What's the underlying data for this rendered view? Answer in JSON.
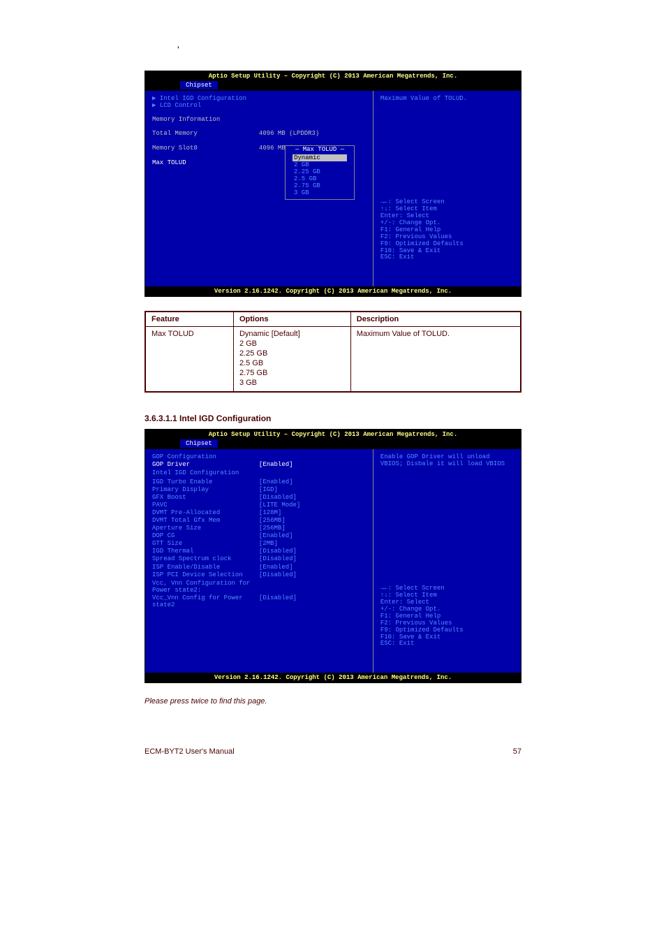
{
  "small_mark": ",",
  "bios1": {
    "header": "Aptio Setup Utility – Copyright (C) 2013 American Megatrends, Inc.",
    "tab": "Chipset",
    "rows": {
      "link1": "▶ Intel IGD Configuration",
      "link2": "▶ LCD Control",
      "meminfo": "Memory Information",
      "totalmem_l": "Total Memory",
      "totalmem_v": "4096 MB (LPDDR3)",
      "memslot_l": "Memory Slot0",
      "memslot_v": "4096 MB (LPDDR3)",
      "maxtolud_l": "Max TOLUD"
    },
    "popup": {
      "title": "— Max TOLUD —",
      "opts": [
        "Dynamic",
        "2 GB",
        "2.25 GB",
        "2.5 GB",
        "2.75 GB",
        "3 GB"
      ]
    },
    "help_top": "Maximum Value of TOLUD.",
    "help": [
      "→←: Select Screen",
      "↑↓: Select Item",
      "Enter: Select",
      "+/-: Change Opt.",
      "F1: General Help",
      "F2: Previous Values",
      "F9: Optimized Defaults",
      "F10: Save & Exit",
      "ESC: Exit"
    ],
    "footer": "Version 2.16.1242. Copyright (C) 2013 American Megatrends, Inc."
  },
  "table1": {
    "headers": [
      "Feature",
      "Options",
      "Description"
    ],
    "row": {
      "feature": "Max TOLUD",
      "options": [
        "Dynamic [Default]",
        "2 GB",
        "2.25 GB",
        "2.5 GB",
        "2.75 GB",
        "3 GB"
      ],
      "desc": "Maximum Value of TOLUD."
    }
  },
  "section_title": "3.6.3.1.1 Intel IGD Configuration",
  "bios2": {
    "header": "Aptio Setup Utility – Copyright (C) 2013 American Megatrends, Inc.",
    "tab": "Chipset",
    "rows": [
      {
        "l": "GOP Configuration",
        "v": ""
      },
      {
        "l": "GOP Driver",
        "v": "[Enabled]",
        "hl": true
      },
      {
        "l": "",
        "v": ""
      },
      {
        "l": "Intel IGD Configuration",
        "v": ""
      },
      {
        "l": "",
        "v": ""
      },
      {
        "l": "",
        "v": ""
      },
      {
        "l": "IGD Turbo Enable",
        "v": "[Enabled]"
      },
      {
        "l": "Primary Display",
        "v": "[IGD]"
      },
      {
        "l": "GFX Boost",
        "v": "[Disabled]"
      },
      {
        "l": "PAVC",
        "v": "[LITE Mode]"
      },
      {
        "l": "DVMT Pre-Allocated",
        "v": "[128M]"
      },
      {
        "l": "DVMT Total Gfx Mem",
        "v": "[256MB]"
      },
      {
        "l": "Aperture Size",
        "v": "[256MB]"
      },
      {
        "l": "DOP CG",
        "v": "[Enabled]"
      },
      {
        "l": "GTT Size",
        "v": "[2MB]"
      },
      {
        "l": "IGD Thermal",
        "v": "[Disabled]"
      },
      {
        "l": "Spread Spectrum clock",
        "v": "[Disabled]"
      },
      {
        "l": "",
        "v": ""
      },
      {
        "l": "ISP Enable/Disable",
        "v": "[Enabled]"
      },
      {
        "l": "ISP PCI Device Selection",
        "v": "[Disabled]"
      },
      {
        "l": "",
        "v": ""
      },
      {
        "l": "Vcc, Vnn Configuration for Power state2:",
        "v": ""
      },
      {
        "l": "Vcc_Vnn Config for Power state2",
        "v": "[Disabled]"
      }
    ],
    "help_top": "Enable GOP Driver will unload VBIOS; Disbale it will load VBIOS",
    "help": [
      "→←: Select Screen",
      "↑↓: Select Item",
      "Enter: Select",
      "+/-: Change Opt.",
      "F1: General Help",
      "F2: Previous Values",
      "F9: Optimized Defaults",
      "F10: Save & Exit",
      "ESC: Exit"
    ],
    "footer": "Version 2.16.1242. Copyright (C) 2013 American Megatrends, Inc."
  },
  "note": "Please press twice to find this page.",
  "footer_text": "ECM-BYT2 User's Manual",
  "pagenum": "57"
}
